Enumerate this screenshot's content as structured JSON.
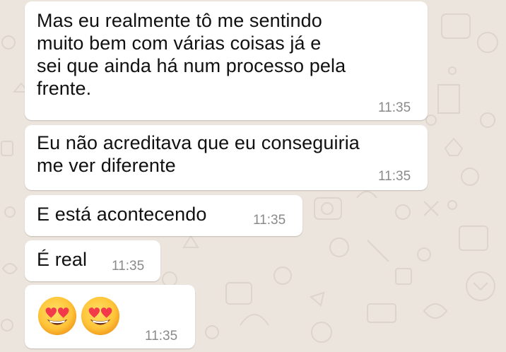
{
  "chat": {
    "messages": [
      {
        "id": "m1",
        "text": "Mas eu realmente tô me sentindo\nmuito bem com várias coisas já e\nsei que ainda há num processo pela\nfrente.",
        "time": "11:35"
      },
      {
        "id": "m2",
        "text": "Eu não acreditava que eu conseguiria\nme ver diferente",
        "time": "11:35"
      },
      {
        "id": "m3",
        "text": "E está acontecendo",
        "time": "11:35"
      },
      {
        "id": "m4",
        "text": "É real",
        "time": "11:35"
      },
      {
        "id": "m5",
        "emojis": [
          "heart-eyes-emoji",
          "heart-eyes-emoji"
        ],
        "time": "11:35"
      }
    ]
  },
  "colors": {
    "wallpaper": "#ECE5DD",
    "bubble": "#FFFFFF",
    "text": "#111111",
    "timestamp": "#8A8A8A"
  }
}
